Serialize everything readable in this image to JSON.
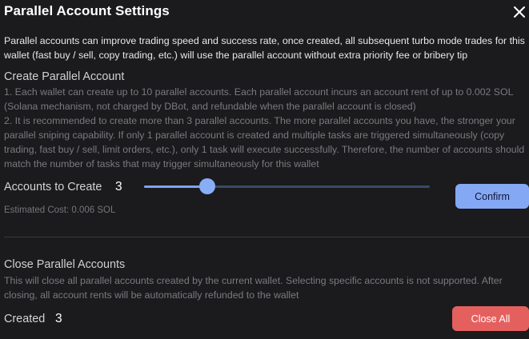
{
  "dialog": {
    "title": "Parallel Account Settings",
    "close_icon": "close-icon",
    "intro": "Parallel accounts can improve trading speed and success rate, once created, all subsequent turbo mode trades for this wallet (fast buy / sell, copy trading, etc.) will use the parallel account without extra priority fee or bribery tip"
  },
  "create": {
    "title": "Create Parallel Account",
    "desc_1": "1. Each wallet can create up to 10 parallel accounts. Each parallel account incurs an account rent of up to 0.002 SOL (Solana mechanism, not charged by DBot, and refundable when the parallel account is closed)",
    "desc_2": "2. It is recommended to create more than 3 parallel accounts. The more parallel accounts you have, the stronger your parallel sniping capability. If only 1 parallel account is created and multiple tasks are triggered simultaneously (copy trading, fast buy / sell, limit orders, etc.), only 1 task will execute successfully. Therefore, the number of accounts should match the number of tasks that may trigger simultaneously for this wallet",
    "count_label": "Accounts to Create",
    "count_value": "3",
    "slider_fraction": 0.22,
    "confirm_label": "Confirm",
    "estimated_cost": "Estimated Cost: 0.006 SOL"
  },
  "close": {
    "title": "Close Parallel Accounts",
    "desc": "This will close all parallel accounts created by the current wallet. Selecting specific accounts is not supported. After closing, all account rents will be automatically refunded to the wallet",
    "created_label": "Created",
    "created_value": "3",
    "close_all_label": "Close All"
  },
  "colors": {
    "background": "#1b1b1d",
    "accent": "#85a8f5",
    "danger": "#e4605e"
  }
}
